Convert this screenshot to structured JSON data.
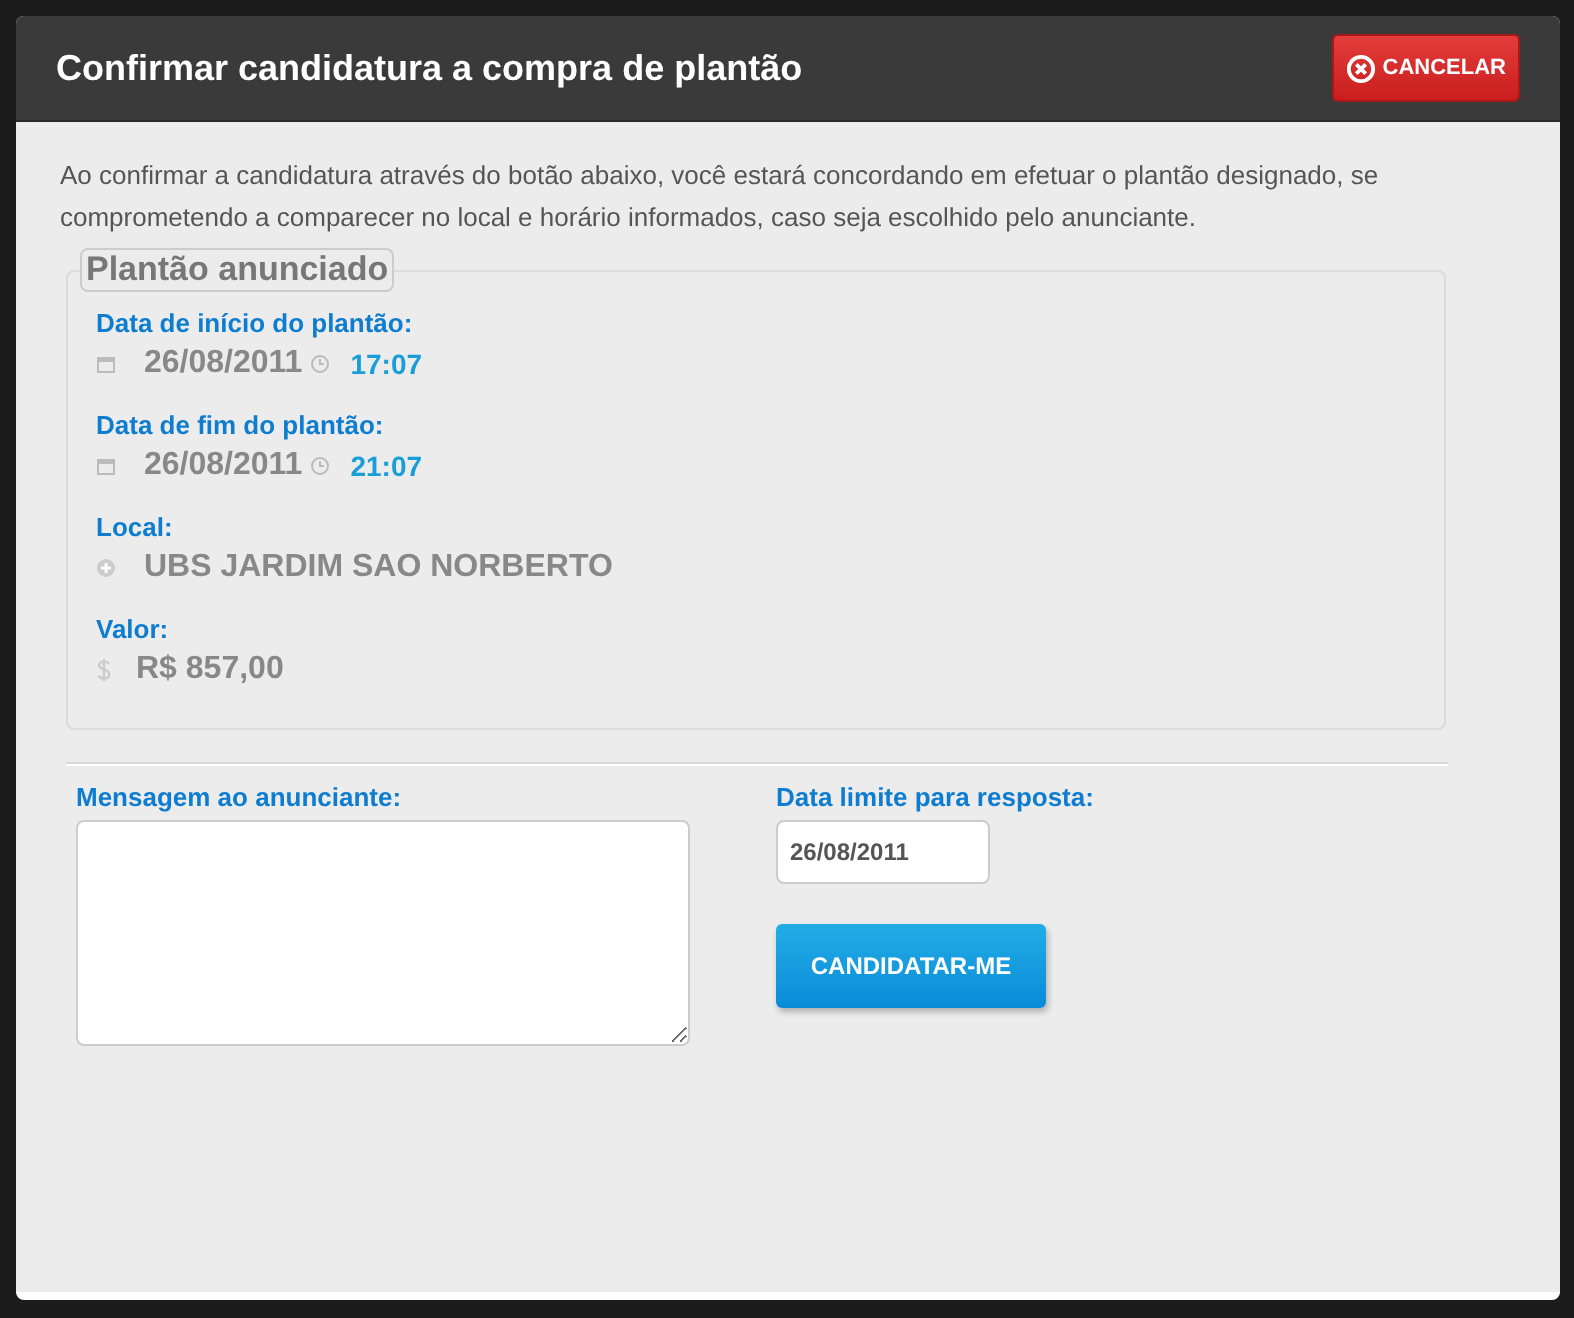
{
  "dialog": {
    "title": "Confirmar candidatura a compra de plantão",
    "close_button": "CANCELAR",
    "intro": "Ao confirmar a candidatura através do botão abaixo, você estará concordando em efetuar o plantão designado, se comprometendo a comparecer no local e horário informados, caso seja escolhido pelo anunciante.",
    "fieldset": {
      "legend": "Plantão anunciado",
      "fields": [
        {
          "kind": "datetime",
          "label": "Data de início do plantão:",
          "date": "26/08/2011",
          "time": "17:07"
        },
        {
          "kind": "datetime",
          "label": "Data de fim do plantão:",
          "date": "26/08/2011",
          "time": "21:07"
        },
        {
          "kind": "place",
          "label": "Local:",
          "value": "UBS JARDIM SAO NORBERTO"
        },
        {
          "kind": "money",
          "label": "Valor:",
          "value": "R$ 857,00"
        }
      ]
    },
    "message": {
      "label": "Mensagem ao anunciante:"
    },
    "deadline": {
      "label": "Data limite para resposta:",
      "value": "26/08/2011"
    },
    "submit_button": "CANDIDATAR-ME"
  }
}
